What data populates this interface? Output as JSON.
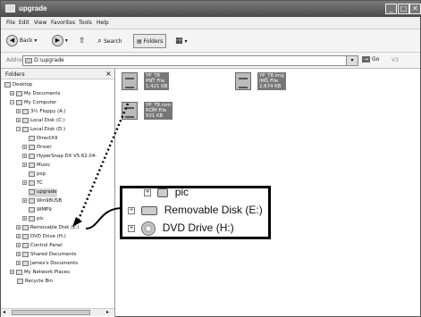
{
  "window": {
    "title": "upgrade",
    "buttons": [
      "_",
      "□",
      "✕"
    ]
  },
  "menu": [
    "File",
    "Edit",
    "View",
    "Favorites",
    "Tools",
    "Help"
  ],
  "toolbar": {
    "back": "Back",
    "search": "Search",
    "folders": "Folders"
  },
  "address": {
    "label": "Address",
    "value": "D:\\upgrade",
    "go": "Go",
    "extra": "V3"
  },
  "folders_pane": {
    "title": "Folders",
    "items": [
      "Desktop",
      "My Documents",
      "My Computer",
      "3½ Floppy (A:)",
      "Local Disk (C:)",
      "Local Disk (D:)",
      "DirectX9",
      "Driver",
      "HyperSnap DX V5.62.04-",
      "Music",
      "pop",
      "TC",
      "upgrade",
      "Win98USB",
      "WMP9",
      "pic",
      "Removable Disk (E:)",
      "DVD Drive (H:)",
      "Control Panel",
      "Shared Documents",
      "James's Documents",
      "My Network Places",
      "Recycle Bin"
    ]
  },
  "files": [
    {
      "name": "YP_T8",
      "type": "PNT File",
      "size": "1,421 KB"
    },
    {
      "name": "YP_T8.img",
      "type": "IMG File",
      "size": "2,674 KB"
    },
    {
      "name": "YP_T8.rom",
      "type": "ROM File",
      "size": "931 KB"
    }
  ],
  "callout": {
    "row0": "pic",
    "row1": "Removable Disk (E:)",
    "row2": "DVD Drive (H:)"
  }
}
